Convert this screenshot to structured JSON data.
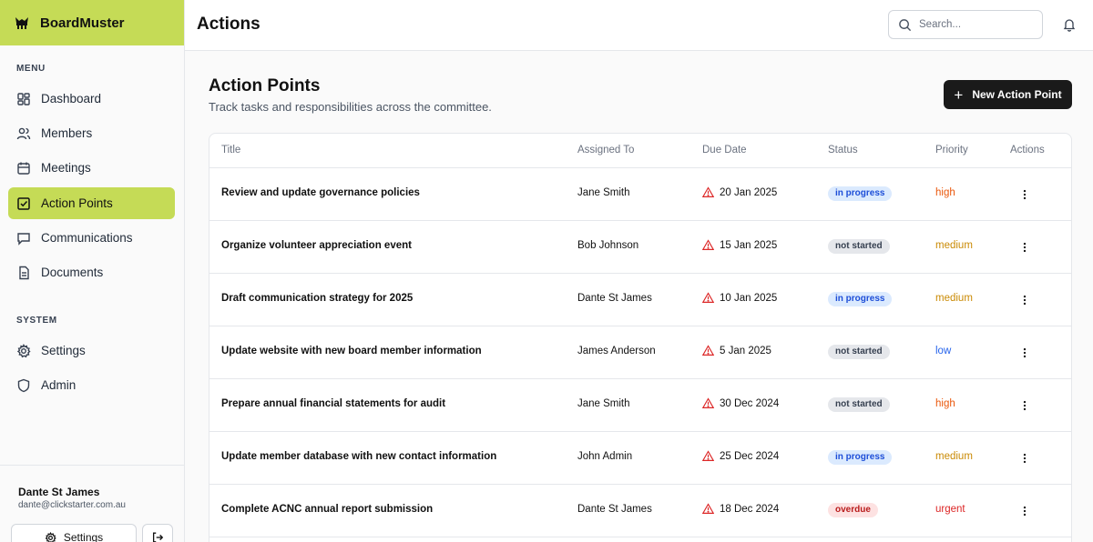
{
  "app": {
    "name": "BoardMuster"
  },
  "sidebar": {
    "menu_label": "MENU",
    "system_label": "SYSTEM",
    "items": [
      {
        "label": "Dashboard",
        "icon": "dashboard-icon"
      },
      {
        "label": "Members",
        "icon": "users-icon"
      },
      {
        "label": "Meetings",
        "icon": "calendar-icon"
      },
      {
        "label": "Action Points",
        "icon": "checkbox-icon",
        "active": true
      },
      {
        "label": "Communications",
        "icon": "message-icon"
      },
      {
        "label": "Documents",
        "icon": "document-icon"
      }
    ],
    "system_items": [
      {
        "label": "Settings",
        "icon": "gear-icon"
      },
      {
        "label": "Admin",
        "icon": "shield-icon"
      }
    ],
    "user": {
      "name": "Dante St James",
      "email": "dante@clickstarter.com.au"
    },
    "footer_settings_label": "Settings"
  },
  "header": {
    "title": "Actions",
    "search_placeholder": "Search..."
  },
  "main": {
    "heading": "Action Points",
    "subtitle": "Track tasks and responsibilities across the committee.",
    "new_button_label": "New Action Point"
  },
  "table": {
    "columns": [
      "Title",
      "Assigned To",
      "Due Date",
      "Status",
      "Priority",
      "Actions"
    ],
    "rows": [
      {
        "title": "Review and update governance policies",
        "assigned": "Jane Smith",
        "due": "20 Jan 2025",
        "status": "in progress",
        "priority": "high"
      },
      {
        "title": "Organize volunteer appreciation event",
        "assigned": "Bob Johnson",
        "due": "15 Jan 2025",
        "status": "not started",
        "priority": "medium"
      },
      {
        "title": "Draft communication strategy for 2025",
        "assigned": "Dante St James",
        "due": "10 Jan 2025",
        "status": "in progress",
        "priority": "medium"
      },
      {
        "title": "Update website with new board member information",
        "assigned": "James Anderson",
        "due": "5 Jan 2025",
        "status": "not started",
        "priority": "low"
      },
      {
        "title": "Prepare annual financial statements for audit",
        "assigned": "Jane Smith",
        "due": "30 Dec 2024",
        "status": "not started",
        "priority": "high"
      },
      {
        "title": "Update member database with new contact information",
        "assigned": "John Admin",
        "due": "25 Dec 2024",
        "status": "in progress",
        "priority": "medium"
      },
      {
        "title": "Complete ACNC annual report submission",
        "assigned": "Dante St James",
        "due": "18 Dec 2024",
        "status": "overdue",
        "priority": "urgent"
      }
    ]
  },
  "colors": {
    "accent": "#c5db56",
    "status_in_progress_bg": "#dbeafe",
    "status_in_progress_fg": "#1d4ed8",
    "status_not_started_bg": "#e5e7eb",
    "status_not_started_fg": "#374151",
    "status_overdue_bg": "#fde2e2",
    "status_overdue_fg": "#b91c1c",
    "priority_high": "#ea580c",
    "priority_medium": "#ca8a04",
    "priority_low": "#2563eb",
    "priority_urgent": "#dc2626",
    "warning_icon": "#dc2626"
  }
}
